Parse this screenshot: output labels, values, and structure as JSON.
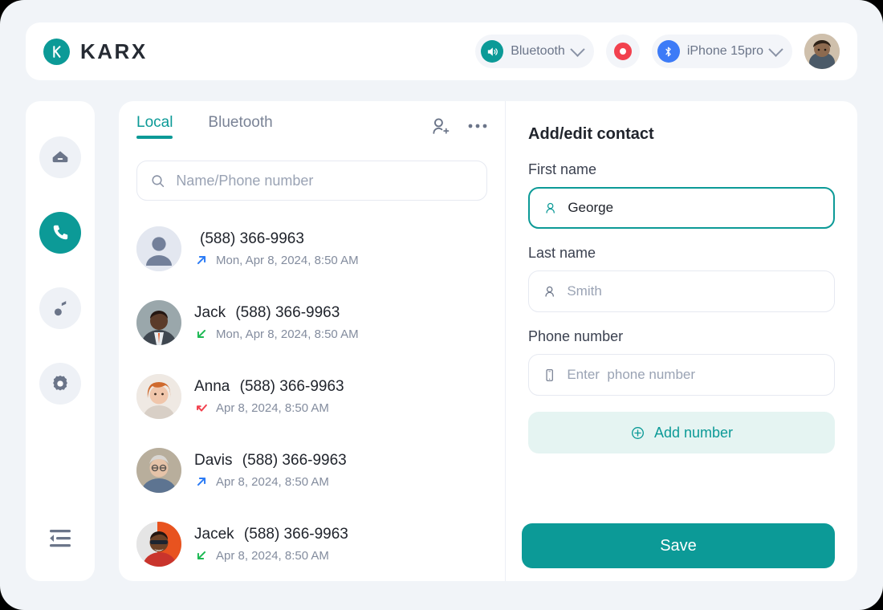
{
  "brand": {
    "name": "KARX",
    "mark_letter": "k",
    "accent": "#0c9a97"
  },
  "header": {
    "audio_pill": {
      "label": "Bluetooth",
      "icon": "speaker-icon"
    },
    "record_button": {
      "name": "record-button",
      "color": "#f2414e"
    },
    "device_pill": {
      "label": "iPhone 15pro",
      "icon": "bluetooth-icon"
    },
    "profile_avatar": "user-avatar"
  },
  "sidebar": {
    "items": [
      {
        "name": "home",
        "icon": "home-icon",
        "active": false
      },
      {
        "name": "calls",
        "icon": "phone-icon",
        "active": true
      },
      {
        "name": "music",
        "icon": "music-note-icon",
        "active": false
      },
      {
        "name": "settings",
        "icon": "gear-icon",
        "active": false
      }
    ],
    "collapse": {
      "name": "collapse-sidebar",
      "icon": "collapse-icon"
    }
  },
  "list_pane": {
    "tabs": [
      {
        "label": "Local",
        "active": true
      },
      {
        "label": "Bluetooth",
        "active": false
      }
    ],
    "actions": [
      {
        "name": "add-contact",
        "icon": "person-plus-icon"
      },
      {
        "name": "more-options",
        "icon": "ellipsis-icon"
      }
    ],
    "search": {
      "placeholder": "Name/Phone number",
      "value": "",
      "icon": "search-icon"
    },
    "contacts": [
      {
        "name": "",
        "number": "(588) 366-9963",
        "time": "Mon, Apr 8, 2024, 8:50 AM",
        "direction": "outgoing",
        "direction_color": "#2b7bf5",
        "avatar": "placeholder-avatar"
      },
      {
        "name": "Jack",
        "number": "(588) 366-9963",
        "time": "Mon, Apr 8, 2024, 8:50 AM",
        "direction": "incoming",
        "direction_color": "#1db954",
        "avatar": "photo-avatar"
      },
      {
        "name": "Anna",
        "number": "(588) 366-9963",
        "time": "Apr 8, 2024, 8:50 AM",
        "direction": "missed",
        "direction_color": "#f2414e",
        "avatar": "photo-avatar"
      },
      {
        "name": "Davis",
        "number": "(588) 366-9963",
        "time": "Apr 8, 2024, 8:50 AM",
        "direction": "outgoing",
        "direction_color": "#2b7bf5",
        "avatar": "photo-avatar"
      },
      {
        "name": "Jacek",
        "number": "(588) 366-9963",
        "time": "Apr 8, 2024, 8:50 AM",
        "direction": "incoming",
        "direction_color": "#1db954",
        "avatar": "photo-avatar"
      }
    ]
  },
  "form": {
    "title": "Add/edit contact",
    "first_name": {
      "label": "First name",
      "value": "George",
      "placeholder": "",
      "icon": "person-icon",
      "focused": true
    },
    "last_name": {
      "label": "Last name",
      "value": "",
      "placeholder": "Smith",
      "icon": "person-icon",
      "focused": false
    },
    "phone": {
      "label": "Phone number",
      "value": "",
      "placeholder": "Enter  phone number",
      "icon": "phone-device-icon",
      "focused": false
    },
    "add_number": {
      "label": "Add number",
      "icon": "plus-circle-icon"
    },
    "save": {
      "label": "Save"
    }
  }
}
